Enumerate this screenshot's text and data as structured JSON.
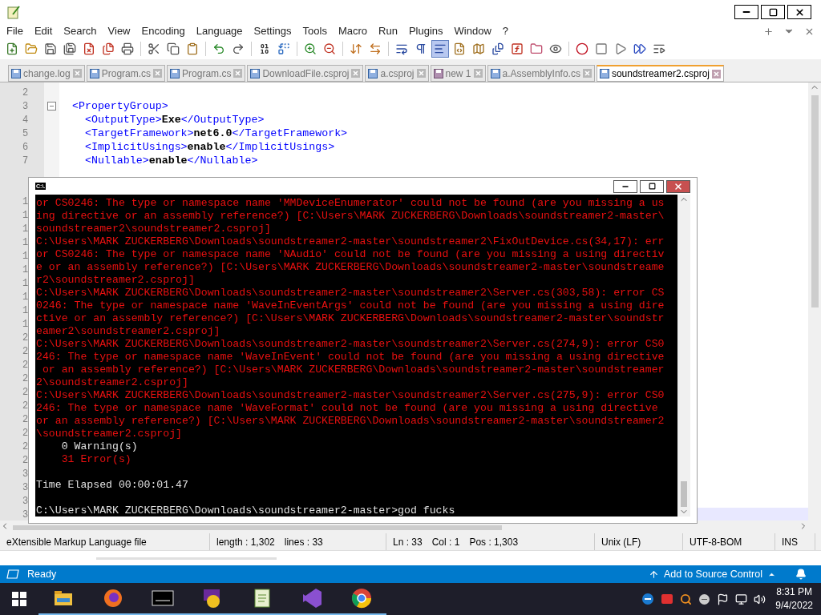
{
  "menu": [
    "File",
    "Edit",
    "Search",
    "View",
    "Encoding",
    "Language",
    "Settings",
    "Tools",
    "Macro",
    "Run",
    "Plugins",
    "Window",
    "?"
  ],
  "toolbar_groups": [
    {
      "buttons": [
        {
          "pressed": false
        },
        {
          "pressed": false
        },
        {
          "pressed": false
        },
        {
          "pressed": false
        },
        {
          "pressed": false
        },
        {
          "pressed": false
        },
        {
          "pressed": false
        }
      ]
    },
    {
      "buttons": [
        {
          "pressed": false
        },
        {
          "pressed": false
        },
        {
          "pressed": false
        }
      ]
    },
    {
      "buttons": [
        {
          "pressed": false
        },
        {
          "pressed": false
        }
      ]
    },
    {
      "buttons": [
        {
          "pressed": false
        },
        {
          "pressed": false
        }
      ]
    },
    {
      "buttons": [
        {
          "pressed": false
        },
        {
          "pressed": false
        }
      ]
    },
    {
      "buttons": [
        {
          "pressed": false
        },
        {
          "pressed": false
        }
      ]
    },
    {
      "buttons": [
        {
          "pressed": false
        },
        {
          "pressed": false
        },
        {
          "pressed": true
        },
        {
          "pressed": false
        },
        {
          "pressed": false
        },
        {
          "pressed": false
        },
        {
          "pressed": false
        },
        {
          "pressed": false
        },
        {
          "pressed": false
        }
      ]
    },
    {
      "buttons": [
        {
          "pressed": false
        },
        {
          "pressed": false
        },
        {
          "pressed": false
        },
        {
          "pressed": false
        },
        {
          "pressed": false
        }
      ]
    }
  ],
  "tabs": [
    {
      "label": "change.log",
      "selected": false,
      "kind": "saved"
    },
    {
      "label": "Program.cs",
      "selected": false,
      "kind": "saved"
    },
    {
      "label": "Program.cs",
      "selected": false,
      "kind": "saved"
    },
    {
      "label": "DownloadFile.csproj",
      "selected": false,
      "kind": "saved"
    },
    {
      "label": "a.csproj",
      "selected": false,
      "kind": "saved"
    },
    {
      "label": "new 1",
      "selected": false,
      "kind": "new"
    },
    {
      "label": "a.AssemblyInfo.cs",
      "selected": false,
      "kind": "saved"
    },
    {
      "label": "soundstreamer2.csproj",
      "selected": true,
      "kind": "saved"
    }
  ],
  "editor": {
    "lines": [
      {
        "number": "2",
        "current": false
      },
      {
        "number": "3",
        "current": false,
        "fold": true,
        "segments": [
          {
            "kind": "tag",
            "text": "  <PropertyGroup>"
          }
        ]
      },
      {
        "number": "4",
        "current": false,
        "segments": [
          {
            "kind": "tag",
            "text": "    <OutputType>"
          },
          {
            "kind": "text",
            "text": "Exe"
          },
          {
            "kind": "tag",
            "text": "</OutputType>"
          }
        ]
      },
      {
        "number": "5",
        "current": false,
        "segments": [
          {
            "kind": "tag",
            "text": "    <TargetFramework>"
          },
          {
            "kind": "text",
            "text": "net6.0"
          },
          {
            "kind": "tag",
            "text": "</TargetFramework>"
          }
        ]
      },
      {
        "number": "6",
        "current": false,
        "segments": [
          {
            "kind": "tag",
            "text": "    <ImplicitUsings>"
          },
          {
            "kind": "text",
            "text": "enable"
          },
          {
            "kind": "tag",
            "text": "</ImplicitUsings>"
          }
        ]
      },
      {
        "number": "7",
        "current": false,
        "segments": [
          {
            "kind": "tag",
            "text": "    <Nullable>"
          },
          {
            "kind": "text",
            "text": "enable"
          },
          {
            "kind": "tag",
            "text": "</Nullable>"
          }
        ]
      },
      {
        "current": false
      },
      {
        "current": false
      },
      {
        "number": "1",
        "current": false
      },
      {
        "number": "1",
        "current": false
      },
      {
        "number": "1",
        "current": false
      },
      {
        "number": "1",
        "current": false
      },
      {
        "number": "1",
        "current": false
      },
      {
        "number": "1",
        "current": false
      },
      {
        "number": "1",
        "current": false
      },
      {
        "number": "1",
        "current": false
      },
      {
        "number": "1",
        "current": false
      },
      {
        "number": "1",
        "current": false
      },
      {
        "number": "2",
        "current": false
      },
      {
        "number": "2",
        "current": false
      },
      {
        "number": "2",
        "current": false
      },
      {
        "number": "2",
        "current": false
      },
      {
        "number": "2",
        "current": false
      },
      {
        "number": "2",
        "current": false
      },
      {
        "number": "2",
        "current": false
      },
      {
        "number": "2",
        "current": false
      },
      {
        "number": "2",
        "current": false
      },
      {
        "number": "2",
        "current": false
      },
      {
        "number": "3",
        "current": false
      },
      {
        "number": "3",
        "current": false
      },
      {
        "number": "3",
        "current": false
      },
      {
        "number": "3",
        "current": true
      }
    ]
  },
  "console": {
    "title_icon": "C:\\.",
    "lines": [
      {
        "kind": "error",
        "text": "or CS0246: The type or namespace name 'MMDeviceEnumerator' could not be found (are you missing a us"
      },
      {
        "kind": "error",
        "text": "ing directive or an assembly reference?) [C:\\Users\\MARK ZUCKERBERG\\Downloads\\soundstreamer2-master\\"
      },
      {
        "kind": "error",
        "text": "soundstreamer2\\soundstreamer2.csproj]"
      },
      {
        "kind": "error",
        "text": "C:\\Users\\MARK ZUCKERBERG\\Downloads\\soundstreamer2-master\\soundstreamer2\\FixOutDevice.cs(34,17): err"
      },
      {
        "kind": "error",
        "text": "or CS0246: The type or namespace name 'NAudio' could not be found (are you missing a using directiv"
      },
      {
        "kind": "error",
        "text": "e or an assembly reference?) [C:\\Users\\MARK ZUCKERBERG\\Downloads\\soundstreamer2-master\\soundstreame"
      },
      {
        "kind": "error",
        "text": "r2\\soundstreamer2.csproj]"
      },
      {
        "kind": "error",
        "text": "C:\\Users\\MARK ZUCKERBERG\\Downloads\\soundstreamer2-master\\soundstreamer2\\Server.cs(303,58): error CS"
      },
      {
        "kind": "error",
        "text": "0246: The type or namespace name 'WaveInEventArgs' could not be found (are you missing a using dire"
      },
      {
        "kind": "error",
        "text": "ctive or an assembly reference?) [C:\\Users\\MARK ZUCKERBERG\\Downloads\\soundstreamer2-master\\soundstr"
      },
      {
        "kind": "error",
        "text": "eamer2\\soundstreamer2.csproj]"
      },
      {
        "kind": "error",
        "text": "C:\\Users\\MARK ZUCKERBERG\\Downloads\\soundstreamer2-master\\soundstreamer2\\Server.cs(274,9): error CS0"
      },
      {
        "kind": "error",
        "text": "246: The type or namespace name 'WaveInEvent' could not be found (are you missing a using directive"
      },
      {
        "kind": "error",
        "text": " or an assembly reference?) [C:\\Users\\MARK ZUCKERBERG\\Downloads\\soundstreamer2-master\\soundstreamer"
      },
      {
        "kind": "error",
        "text": "2\\soundstreamer2.csproj]"
      },
      {
        "kind": "error",
        "text": "C:\\Users\\MARK ZUCKERBERG\\Downloads\\soundstreamer2-master\\soundstreamer2\\Server.cs(275,9): error CS0"
      },
      {
        "kind": "error",
        "text": "246: The type or namespace name 'WaveFormat' could not be found (are you missing a using directive"
      },
      {
        "kind": "error",
        "text": "or an assembly reference?) [C:\\Users\\MARK ZUCKERBERG\\Downloads\\soundstreamer2-master\\soundstreamer2"
      },
      {
        "kind": "error",
        "text": "\\soundstreamer2.csproj]"
      },
      {
        "kind": "normal",
        "text": "    0 Warning(s)"
      },
      {
        "kind": "error",
        "text": "    31 Error(s)"
      },
      {
        "kind": "blank"
      },
      {
        "kind": "normal",
        "text": "Time Elapsed 00:00:01.47"
      },
      {
        "kind": "blank"
      },
      {
        "kind": "normal",
        "text": "C:\\Users\\MARK ZUCKERBERG\\Downloads\\soundstreamer2-master>god fucks"
      }
    ]
  },
  "status_bar": [
    {
      "texts": [
        "eXtensible Markup Language file"
      ]
    },
    {
      "texts": [
        "length : 1,302",
        "lines : 33"
      ]
    },
    {
      "texts": [
        "Ln : 33",
        "Col : 1",
        "Pos : 1,303"
      ]
    },
    {
      "texts": [
        "Unix (LF)"
      ]
    },
    {
      "texts": [
        "UTF-8-BOM"
      ]
    },
    {
      "texts": [
        "INS"
      ]
    }
  ],
  "vs_status": {
    "state": "Ready",
    "source_control": "Add to Source Control"
  },
  "taskbar": {
    "time": "8:31 PM",
    "date": "9/4/2022"
  }
}
